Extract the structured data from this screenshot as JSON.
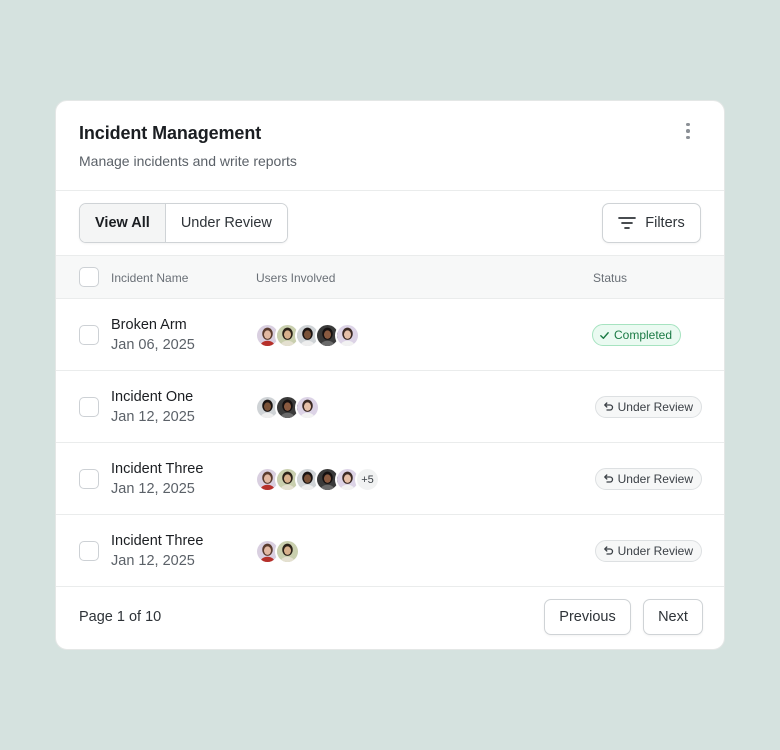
{
  "card": {
    "title": "Incident Management",
    "subtitle": "Manage incidents and write reports",
    "menu_icon": "more-vertical-icon"
  },
  "toolbar": {
    "tabs": [
      {
        "label": "View All",
        "active": true
      },
      {
        "label": "Under Review",
        "active": false
      }
    ],
    "filters_label": "Filters",
    "filters_icon": "filter-lines-icon"
  },
  "table": {
    "columns": {
      "name": "Incident Name",
      "users": "Users Involved",
      "status": "Status"
    },
    "rows": [
      {
        "name": "Broken Arm",
        "date": "Jan 06, 2025",
        "avatars": 5,
        "extra": "",
        "status": "Completed",
        "status_type": "completed"
      },
      {
        "name": "Incident One",
        "date": "Jan 12, 2025",
        "avatars": 3,
        "extra": "",
        "status": "Under Review",
        "status_type": "review"
      },
      {
        "name": "Incident Three",
        "date": "Jan 12, 2025",
        "avatars": 5,
        "extra": "+5",
        "status": "Under Review",
        "status_type": "review"
      },
      {
        "name": "Incident Three",
        "date": "Jan 12, 2025",
        "avatars": 2,
        "extra": "",
        "status": "Under Review",
        "status_type": "review"
      }
    ]
  },
  "pagination": {
    "page_text": "Page 1 of 10",
    "previous_label": "Previous",
    "next_label": "Next"
  },
  "colors": {
    "background": "#d5e2df",
    "completed_bg": "#eafaf1",
    "completed_text": "#1b7a45"
  }
}
